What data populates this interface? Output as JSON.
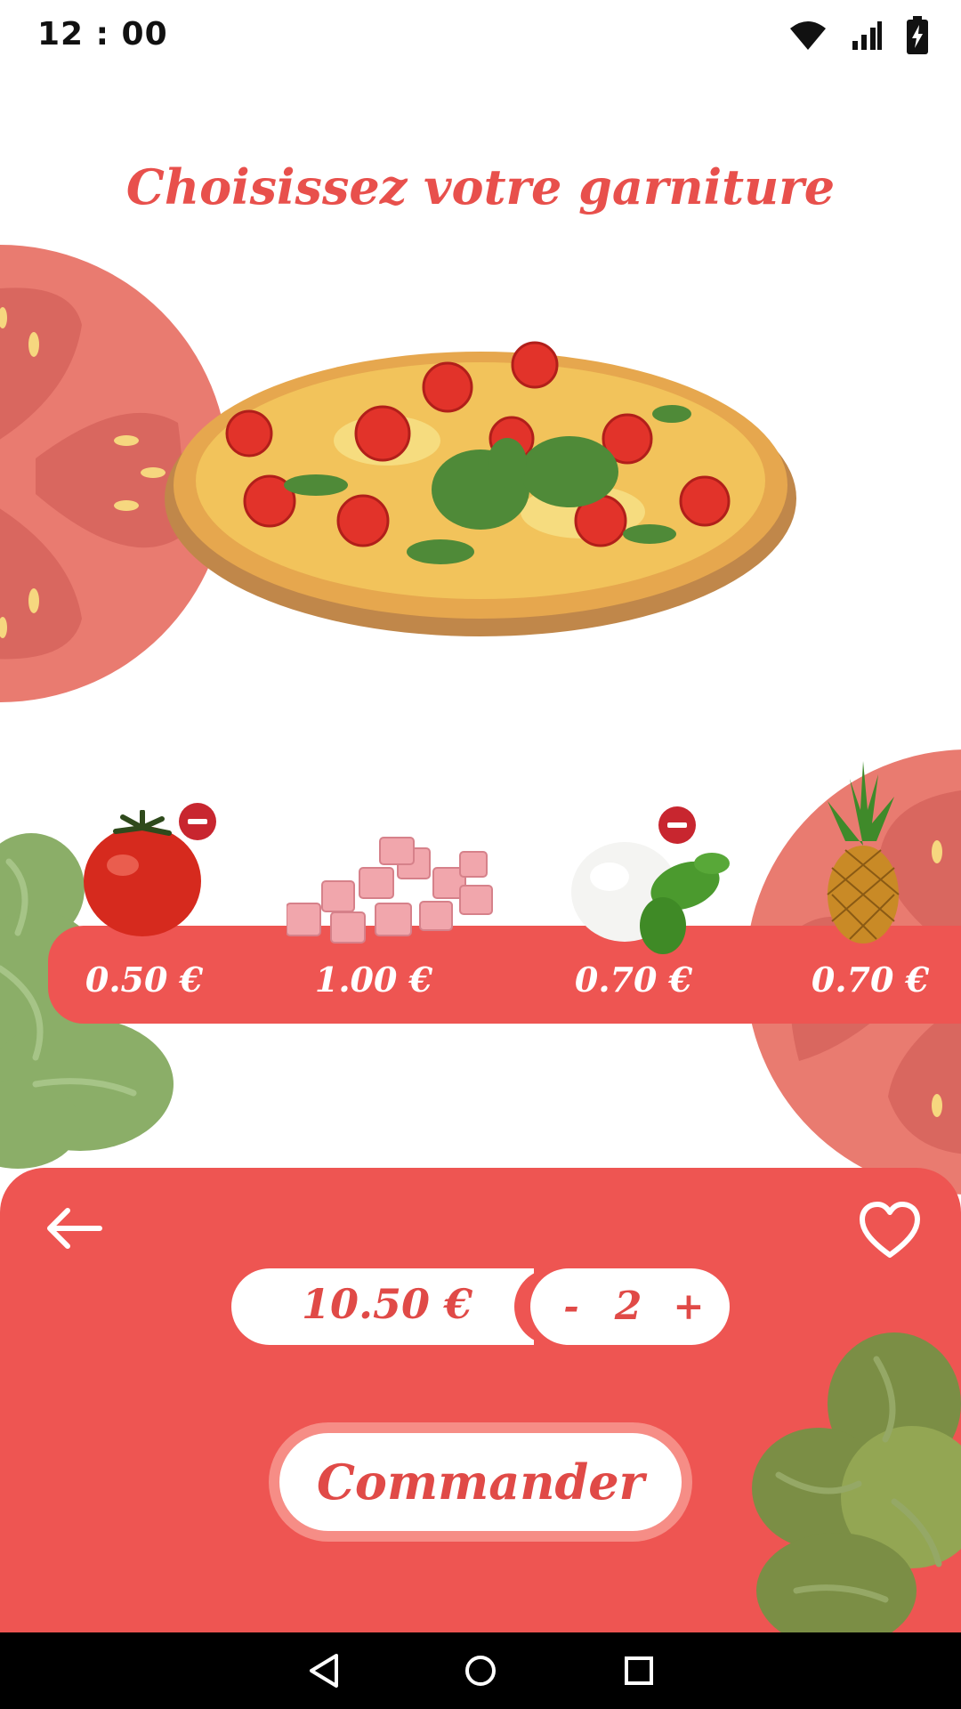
{
  "status_bar": {
    "time": "12 : 00",
    "icons": [
      "wifi-icon",
      "signal-icon",
      "battery-icon"
    ]
  },
  "title": "Choisissez votre garniture",
  "ingredients": [
    {
      "name": "tomato",
      "price": "0.50 €",
      "removable": true
    },
    {
      "name": "ham",
      "price": "1.00 €",
      "removable": false
    },
    {
      "name": "mozzarella",
      "price": "0.70 €",
      "removable": true
    },
    {
      "name": "pineapple",
      "price": "0.70 €",
      "removable": false
    }
  ],
  "order": {
    "total_price": "10.50 €",
    "minus_label": "-",
    "quantity": "2",
    "plus_label": "+",
    "button_label": "Commander"
  },
  "colors": {
    "accent": "#EE5552",
    "title": "#E8504C",
    "remove_badge": "#C8262F",
    "tomato_deco": "#E97B70",
    "leaf_deco": "#8BAE68"
  },
  "nav_bar": {
    "icons": [
      "back-triangle-icon",
      "home-circle-icon",
      "recents-square-icon"
    ]
  }
}
